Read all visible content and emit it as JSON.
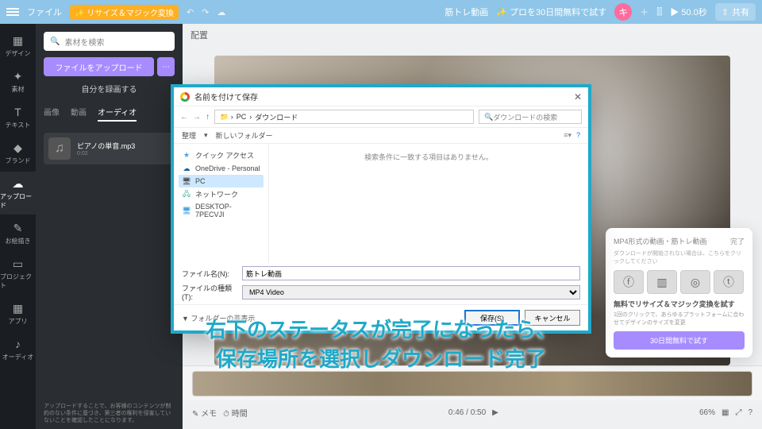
{
  "topbar": {
    "file": "ファイル",
    "resize": "リサイズ＆マジック変換",
    "doc": "筋トレ動画",
    "trial": "プロを30日間無料で試す",
    "avatar": "キ",
    "play": "50.0秒",
    "share": "共有"
  },
  "side": {
    "items": [
      {
        "label": "デザイン",
        "icon": "▦"
      },
      {
        "label": "素材",
        "icon": "✦"
      },
      {
        "label": "テキスト",
        "icon": "T"
      },
      {
        "label": "ブランド",
        "icon": "◆"
      },
      {
        "label": "アップロード",
        "icon": "☁"
      },
      {
        "label": "お絵描き",
        "icon": "✎"
      },
      {
        "label": "プロジェクト",
        "icon": "▭"
      },
      {
        "label": "アプリ",
        "icon": "▦"
      },
      {
        "label": "オーディオ",
        "icon": "♪"
      }
    ]
  },
  "panel": {
    "search": "素材を検索",
    "upload": "ファイルをアップロード",
    "record": "自分を録画する",
    "tabs": [
      "画像",
      "動画",
      "オーディオ"
    ],
    "active_tab": 2,
    "media_name": "ピアノの単音.mp3",
    "media_sub": "0:02",
    "disc": "アップロードすることで、お客様のコンテンツが制約のない条件に基づき、第三者の権利を侵害していないことを確認したことになります。"
  },
  "canvas": {
    "title": "配置",
    "time": "0:46 / 0:50",
    "zoom": "66%"
  },
  "popup": {
    "title": "MP4形式の動画・筋トレ動画",
    "status": "完了",
    "detail": "ダウンロードが開始されない場合は、こちらをクリックしてください",
    "thumbs": [
      "ⓕ",
      "▥",
      "◎",
      "ⓣ"
    ],
    "promo": "無料でリサイズ＆マジック変換を試す",
    "promo_sub": "1回のクリックで、あらゆるプラットフォームに合わせてデザインのサイズを変更",
    "btn": "30日間無料で試す"
  },
  "dialog": {
    "title": "名前を付けて保存",
    "path": {
      "pc": "PC",
      "down": "ダウンロード",
      "search": "ダウンロードの検索"
    },
    "tools": {
      "org": "整理",
      "new": "新しいフォルダー"
    },
    "nav": [
      {
        "label": "クイック アクセス",
        "icon": "★",
        "color": "#4aa3df"
      },
      {
        "label": "OneDrive - Personal",
        "icon": "☁",
        "color": "#0a64a4"
      },
      {
        "label": "PC",
        "icon": "🖥",
        "color": "#555",
        "sel": true
      },
      {
        "label": "ネットワーク",
        "icon": "🖧",
        "color": "#3a8"
      },
      {
        "label": "DESKTOP-7PECVJI",
        "icon": "🖥",
        "color": "#4aa3df"
      }
    ],
    "empty": "検索条件に一致する項目はありません。",
    "file_lbl": "ファイル名(N):",
    "file_val": "筋トレ動画",
    "type_lbl": "ファイルの種類(T):",
    "type_val": "MP4 Video",
    "hide": "フォルダーの非表示",
    "save": "保存(S)",
    "cancel": "キャンセル"
  },
  "caption": {
    "l1": "右下のステータスが完了になったら、",
    "l2": "保存場所を選択しダウンロード完了"
  }
}
